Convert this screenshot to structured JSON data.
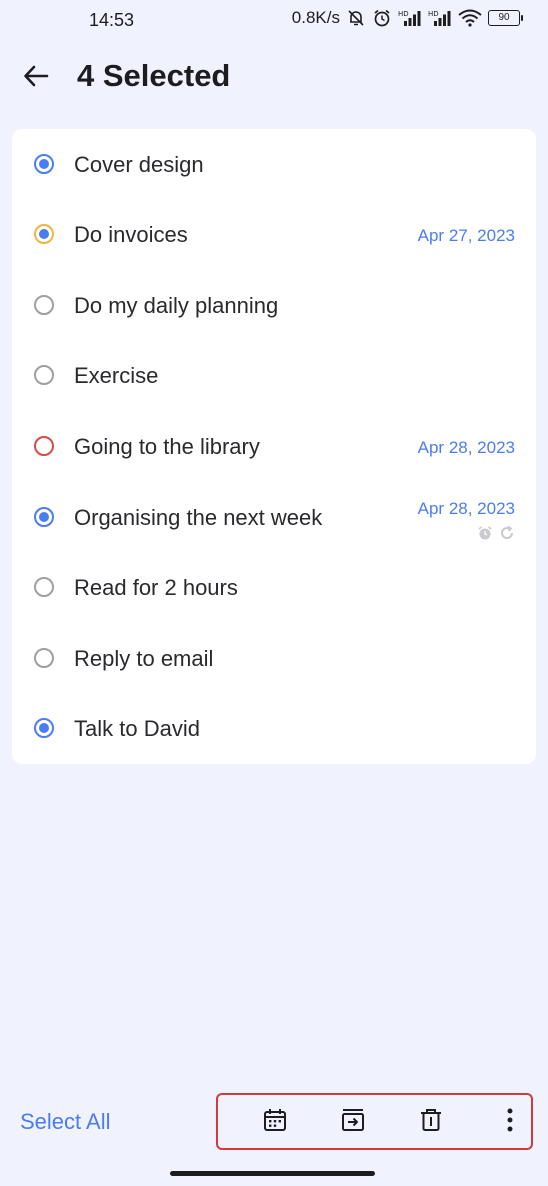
{
  "status_bar": {
    "time": "14:53",
    "network_speed": "0.8K/s",
    "battery": "90",
    "icons": [
      "bell-off-icon",
      "alarm-icon",
      "hd-signal-icon",
      "hd-signal-icon",
      "wifi-icon",
      "battery-icon"
    ]
  },
  "header": {
    "back_icon": "arrow-left-icon",
    "title": "4 Selected"
  },
  "tasks": [
    {
      "label": "Cover design",
      "date": "",
      "state": "checked"
    },
    {
      "label": "Do invoices",
      "date": "Apr 27, 2023",
      "state": "checked-priority-medium"
    },
    {
      "label": "Do my daily planning",
      "date": "",
      "state": "unchecked"
    },
    {
      "label": "Exercise",
      "date": "",
      "state": "unchecked"
    },
    {
      "label": "Going to the library",
      "date": "Apr 28, 2023",
      "state": "unchecked-priority-high"
    },
    {
      "label": "Organising the next week",
      "date": "Apr 28, 2023",
      "state": "checked",
      "icons": [
        "alarm-icon",
        "repeat-icon"
      ]
    },
    {
      "label": "Read for 2 hours",
      "date": "",
      "state": "unchecked"
    },
    {
      "label": "Reply to email",
      "date": "",
      "state": "unchecked"
    },
    {
      "label": "Talk to David",
      "date": "",
      "state": "checked"
    }
  ],
  "bottom_bar": {
    "select_all_label": "Select All",
    "actions": [
      "calendar-icon",
      "move-to-list-icon",
      "trash-icon",
      "more-vertical-icon"
    ]
  },
  "colors": {
    "background": "#f0f2fd",
    "card": "#ffffff",
    "accent": "#4b7cf0",
    "priority_medium": "#f4b33c",
    "priority_high": "#d64a4a",
    "highlight_border": "#d03c3c"
  }
}
